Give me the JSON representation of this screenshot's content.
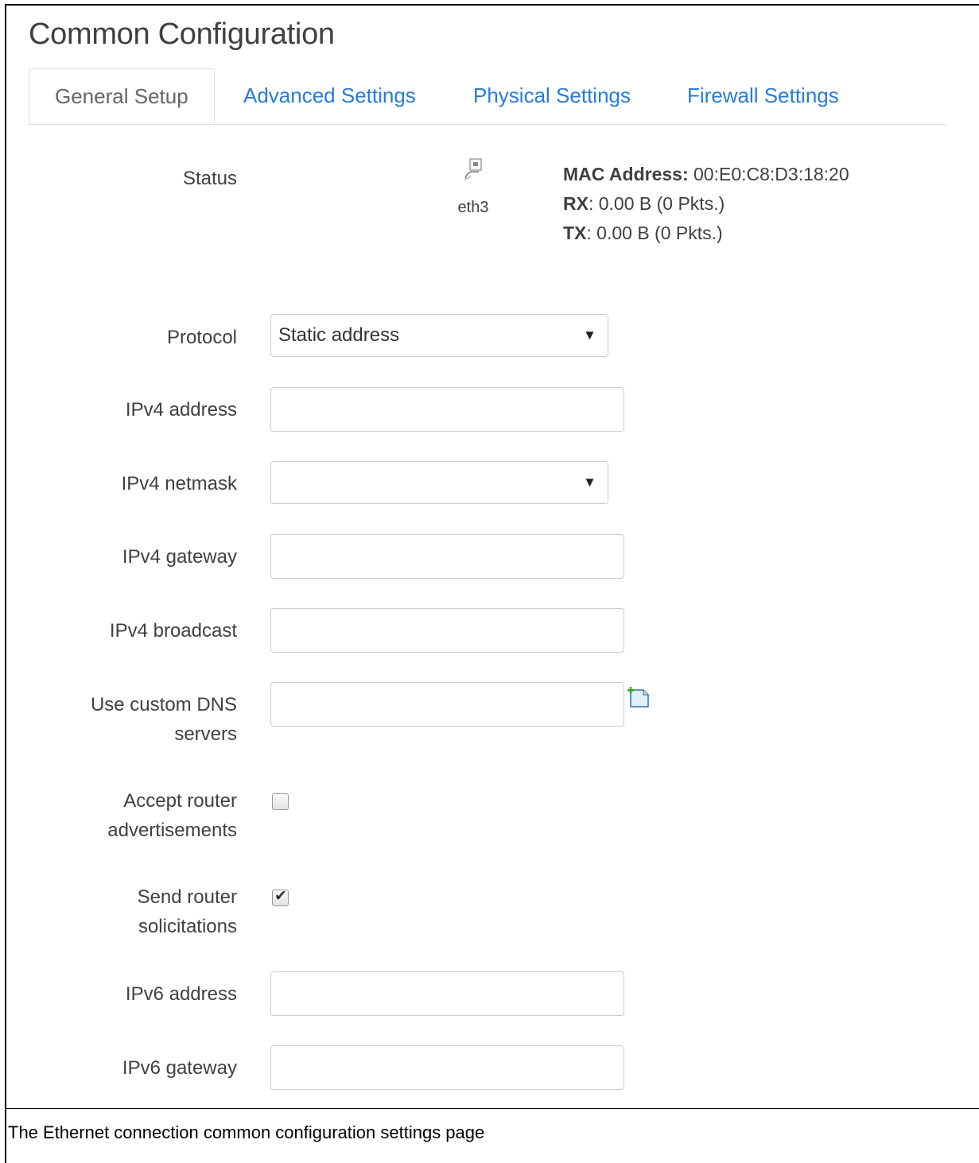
{
  "page": {
    "title": "Common Configuration",
    "caption": "The Ethernet connection common configuration settings page"
  },
  "tabs": [
    {
      "label": "General Setup",
      "active": true
    },
    {
      "label": "Advanced Settings",
      "active": false
    },
    {
      "label": "Physical Settings",
      "active": false
    },
    {
      "label": "Firewall Settings",
      "active": false
    }
  ],
  "status": {
    "label": "Status",
    "device": "eth3",
    "mac_label": "MAC Address:",
    "mac_value": " 00:E0:C8:D3:18:20",
    "rx_label": "RX",
    "rx_value": ": 0.00 B (0 Pkts.)",
    "tx_label": "TX",
    "tx_value": ": 0.00 B (0 Pkts.)",
    "icon": "ethernet-port-icon"
  },
  "form": {
    "protocol": {
      "label": "Protocol",
      "value": "Static address"
    },
    "ipv4_address": {
      "label": "IPv4 address",
      "value": ""
    },
    "ipv4_netmask": {
      "label": "IPv4 netmask",
      "value": ""
    },
    "ipv4_gateway": {
      "label": "IPv4 gateway",
      "value": ""
    },
    "ipv4_broadcast": {
      "label": "IPv4 broadcast",
      "value": ""
    },
    "custom_dns": {
      "label_line1": "Use custom DNS",
      "label_line2": "servers",
      "value": "",
      "add_icon": "add-entry-icon"
    },
    "accept_ra": {
      "label_line1": "Accept router",
      "label_line2": "advertisements",
      "checked": false
    },
    "send_rs": {
      "label_line1": "Send router",
      "label_line2": "solicitations",
      "checked": true
    },
    "ipv6_address": {
      "label": "IPv6 address",
      "value": ""
    },
    "ipv6_gateway": {
      "label": "IPv6 gateway",
      "value": ""
    }
  },
  "colors": {
    "link": "#2a7ad8",
    "text": "#404040",
    "border": "#cccccc"
  }
}
